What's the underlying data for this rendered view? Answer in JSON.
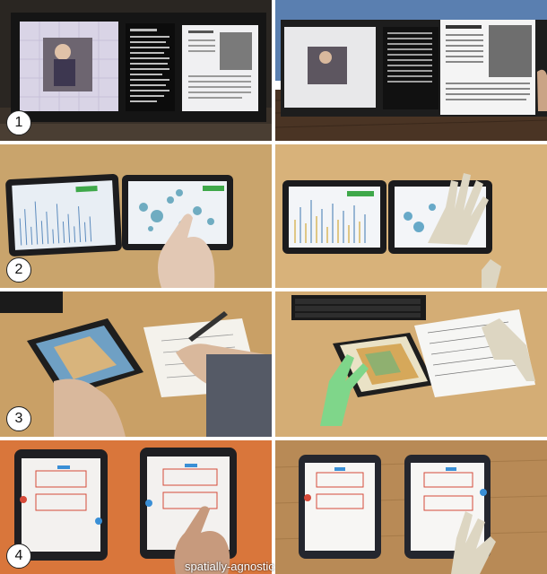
{
  "rows": [
    {
      "badge": "1"
    },
    {
      "badge": "2"
    },
    {
      "badge": "3"
    },
    {
      "badge": "4",
      "caption": "spatially-agnostic"
    }
  ],
  "colors": {
    "wall_dark": "#1b1b1b",
    "table_wood": "#c8a36a",
    "orange_table": "#d9763b",
    "vr_sky": "#5a7fb0",
    "hand_virtual": "#ddd6c2",
    "hand_green": "#7fd68a"
  },
  "icons": {
    "row1": "display-wall-photo",
    "row2": "tablet-chart-photo",
    "row3": "tablet-map-photo",
    "row4": "tablet-ui-photo"
  }
}
